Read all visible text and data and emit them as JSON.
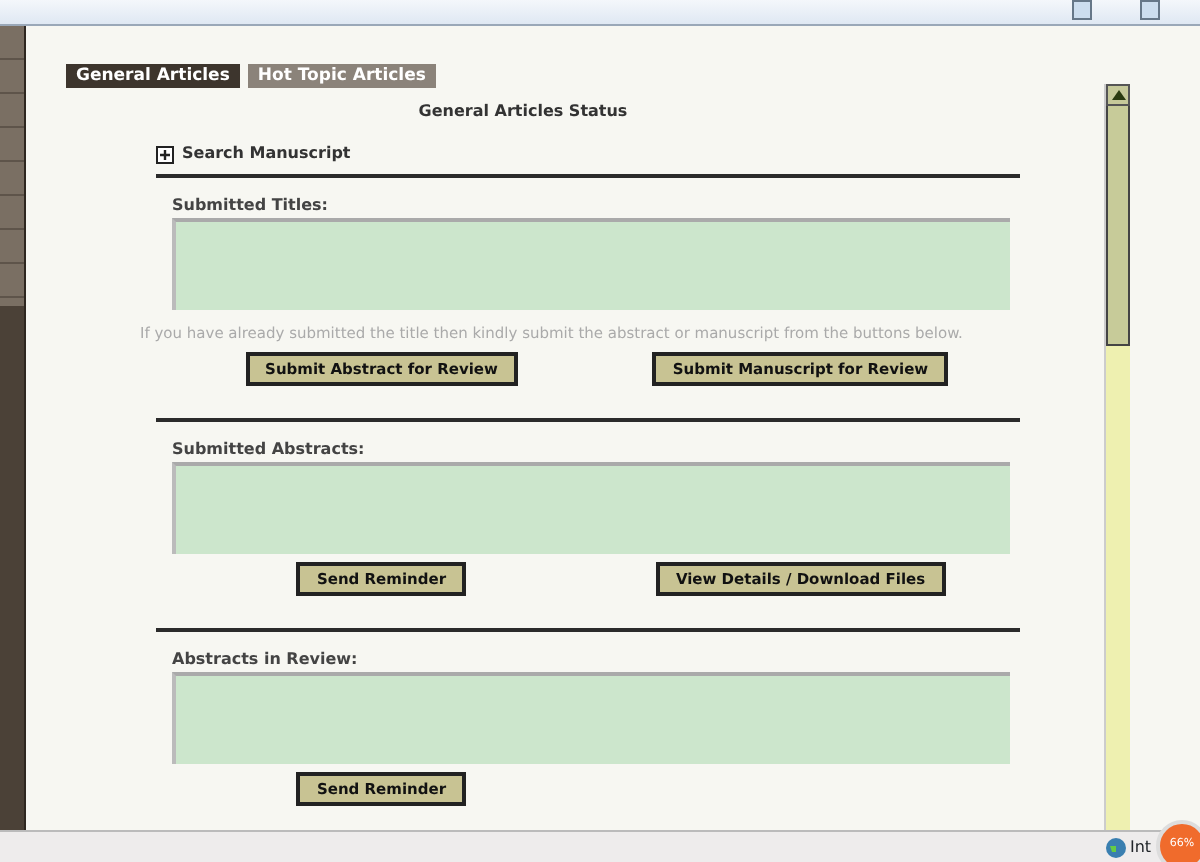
{
  "tabs": [
    {
      "label": "General Articles",
      "selected": true
    },
    {
      "label": "Hot Topic Articles",
      "selected": false
    }
  ],
  "heading": "General Articles Status",
  "search": {
    "label": "Search Manuscript",
    "expanded": false
  },
  "sections": [
    {
      "title": "Submitted Titles:",
      "note": "If you have already submitted the title then kindly submit the abstract or manuscript from the buttons below.",
      "buttons": [
        "Submit Abstract for Review",
        "Submit Manuscript for Review"
      ]
    },
    {
      "title": "Submitted Abstracts:",
      "buttons": [
        "Send Reminder",
        "View Details / Download Files"
      ]
    },
    {
      "title": "Abstracts in Review:",
      "buttons": [
        "Send Reminder"
      ]
    }
  ],
  "status_bar": {
    "zone": "Int",
    "zoom": "66%"
  }
}
